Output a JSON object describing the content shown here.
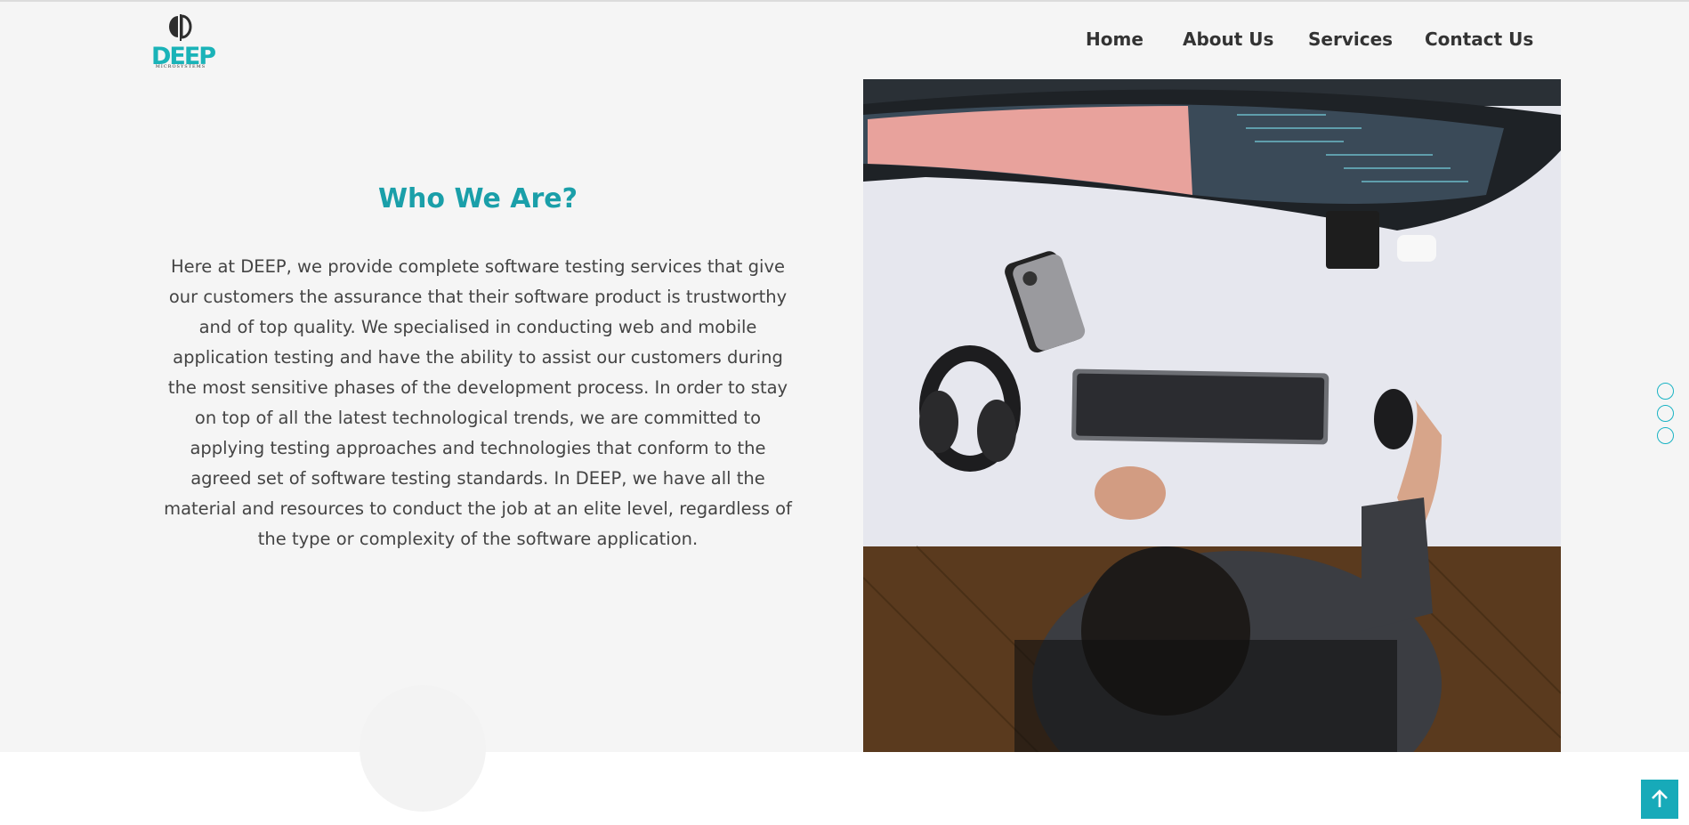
{
  "brand": {
    "name": "DEEP",
    "tagline": "MICROSYSTEMS"
  },
  "nav": {
    "items": [
      {
        "label": "Home"
      },
      {
        "label": "About Us"
      },
      {
        "label": "Services"
      },
      {
        "label": "Contact Us"
      }
    ]
  },
  "about": {
    "title": "Who We Are?",
    "body": "Here at DEEP, we provide complete software testing services that give our customers the assurance that their software product is trustworthy and of top quality. We specialised in conducting web and mobile application testing and have the ability to assist our customers during the most sensitive phases of the development process. In order to stay on top of all the latest technological trends, we are committed to applying testing approaches and technologies that conform to the agreed set of software testing standards. In DEEP, we have all the material and resources to conduct the job at an elite level, regardless of the type or complexity of the software application."
  },
  "slider": {
    "dots": 3
  },
  "colors": {
    "accent": "#1a9fa9",
    "scroll_button": "#17aab9",
    "background": "#f5f5f5",
    "text": "#444444"
  },
  "icons": {
    "scroll_top": "arrow-up-icon"
  }
}
